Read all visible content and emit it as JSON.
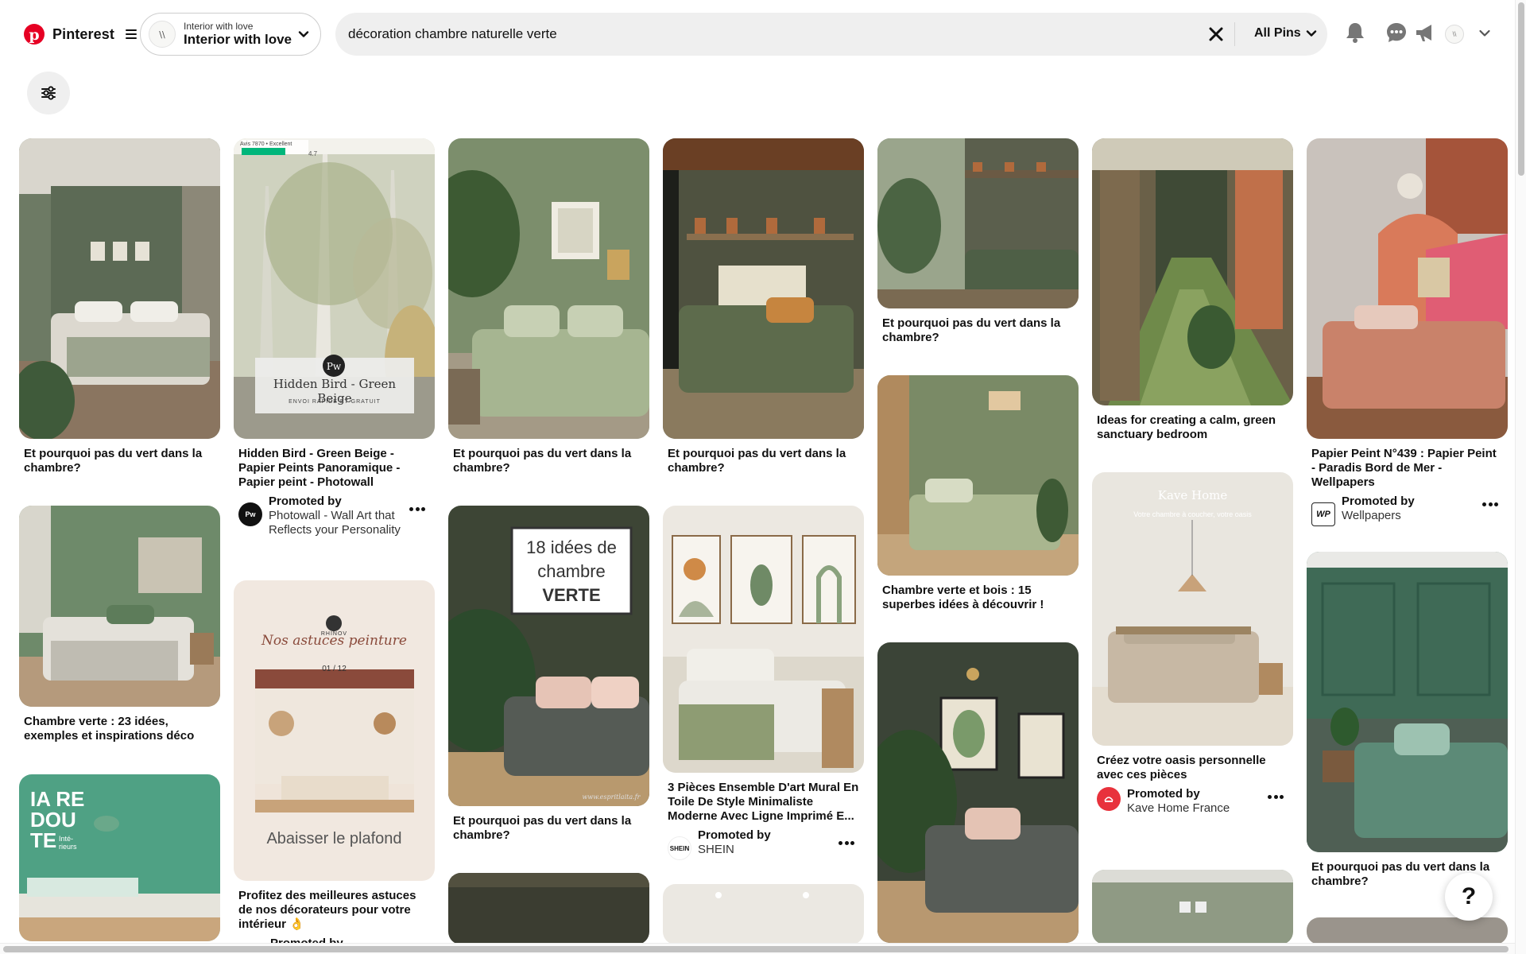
{
  "header": {
    "brand": "Pinterest",
    "account": {
      "subtitle": "Interior with love",
      "name": "Interior with love",
      "avatar_text": "\\\\"
    },
    "search": {
      "value": "décoration chambre naturelle verte",
      "scope": "All Pins"
    },
    "me_avatar_text": "\\\\"
  },
  "colors": {
    "brand_red": "#e60023",
    "search_bg": "#efefef"
  },
  "icons": [
    "pinterest-logo-icon",
    "menu-icon",
    "chevron-down-icon",
    "clear-icon",
    "bell-icon",
    "messages-icon",
    "megaphone-icon",
    "filter-icon",
    "help-icon"
  ],
  "pins": [
    {
      "title": "Et pourquoi pas du vert dans la chambre?"
    },
    {
      "title": "Chambre verte : 23 idées, exemples et inspirations déco"
    },
    {
      "overlay": "IA RE DOU TE Inté-rieurs"
    },
    {
      "title": "Hidden Bird - Green Beige - Papier Peints Panoramique - Papier peint - Photowall",
      "overlay": {
        "rating": "Avis 7870 • Excellent",
        "score": "4.7",
        "product": "Hidden Bird - Green Beige",
        "shipping": "ENVOI RAPIDE ET GRATUIT"
      },
      "promoted_by": "Promoted by",
      "promoter": "Photowall - Wall Art that Reflects your Personality",
      "promoter_logo": "Pw"
    },
    {
      "title": "Profitez des meilleures astuces de nos décorateurs pour votre intérieur 👌",
      "overlay": {
        "brand": "RHINOV",
        "headline": "Nos astuces peinture",
        "counter": "01 / 12",
        "caption": "Abaisser le plafond"
      },
      "partial": "Promoted by"
    },
    {
      "title": "Et pourquoi pas du vert dans la chambre?"
    },
    {
      "title": "Et pourquoi pas du vert dans la chambre?",
      "overlay": {
        "line1": "18 idées de",
        "line2": "chambre",
        "line3": "VERTE",
        "watermark": "www.espritlaita.fr"
      }
    },
    {
      "title": "Et pourquoi pas du vert dans la chambre?"
    },
    {
      "title": "3 Pièces Ensemble D'art Mural En Toile De Style Minimaliste Moderne Avec Ligne Imprimé E...",
      "promoted_by": "Promoted by",
      "promoter": "SHEIN",
      "promoter_logo": "SHEIN"
    },
    {
      "title": "Et pourquoi pas du vert dans la chambre?"
    },
    {
      "title": "Chambre verte et bois : 15 superbes idées à découvrir !"
    },
    {
      "title": "Ideas for creating a calm, green sanctuary bedroom"
    },
    {
      "title": "Créez votre oasis personnelle avec ces pièces",
      "overlay": {
        "brand": "Kave Home",
        "tagline": "Votre chambre à coucher, votre oasis"
      },
      "promoted_by": "Promoted by",
      "promoter": "Kave Home France"
    },
    {
      "title": "Papier Peint N°439 : Papier Peint - Paradis Bord de Mer - Wellpapers",
      "promoted_by": "Promoted by",
      "promoter": "Wellpapers",
      "promoter_logo": "WP"
    },
    {
      "title": "Et pourquoi pas du vert dans la chambre?"
    }
  ],
  "help_label": "?"
}
